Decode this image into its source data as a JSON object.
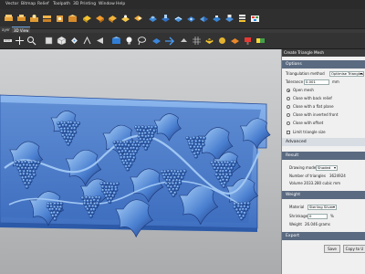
{
  "menu": {
    "items": [
      "Vector",
      "Bitmap",
      "Relief",
      "Toolpath",
      "3D Printing",
      "Window",
      "Help"
    ]
  },
  "tabs": {
    "left_label": "ayer",
    "view_label": "3D View"
  },
  "panel": {
    "title": "Create Triangle Mesh",
    "options_header": "Options",
    "triangulation_label": "Triangulation method",
    "triangulation_value": "Optimise Triangles",
    "tolerance_label": "Tolerance",
    "tolerance_value": "0.001",
    "tolerance_unit": "mm",
    "radio_open": "Open mesh",
    "radio_back": "Close with back relief",
    "radio_flat": "Close with a flat plane",
    "radio_inverted": "Close with inverted front",
    "radio_offset": "Close with offset",
    "limit_label": "Limit triangle size",
    "advanced_header": "Advanced",
    "result_header": "Result",
    "drawing_mode_label": "Drawing mode",
    "drawing_mode_value": "Shaded",
    "triangles_label": "Number of triangles",
    "triangles_value": "3624924",
    "volume_label": "Volume",
    "volume_value": "2033.280 cubic mm",
    "weight_header": "Weight",
    "material_label": "Material",
    "material_value": "Sterling Silver",
    "shrinkage_label": "Shrinkage",
    "shrinkage_value": "0",
    "shrinkage_unit": "%",
    "weight_label": "Weight",
    "weight_value": "26.046 grams",
    "export_header": "Export",
    "save_label": "Save",
    "copy_label": "Copy to U"
  },
  "colors": {
    "relief": "#4a7fd0",
    "relief_dark": "#1f3f8a",
    "viewport_bg": "#c4c6c8",
    "section_header": "#5a6a80"
  }
}
